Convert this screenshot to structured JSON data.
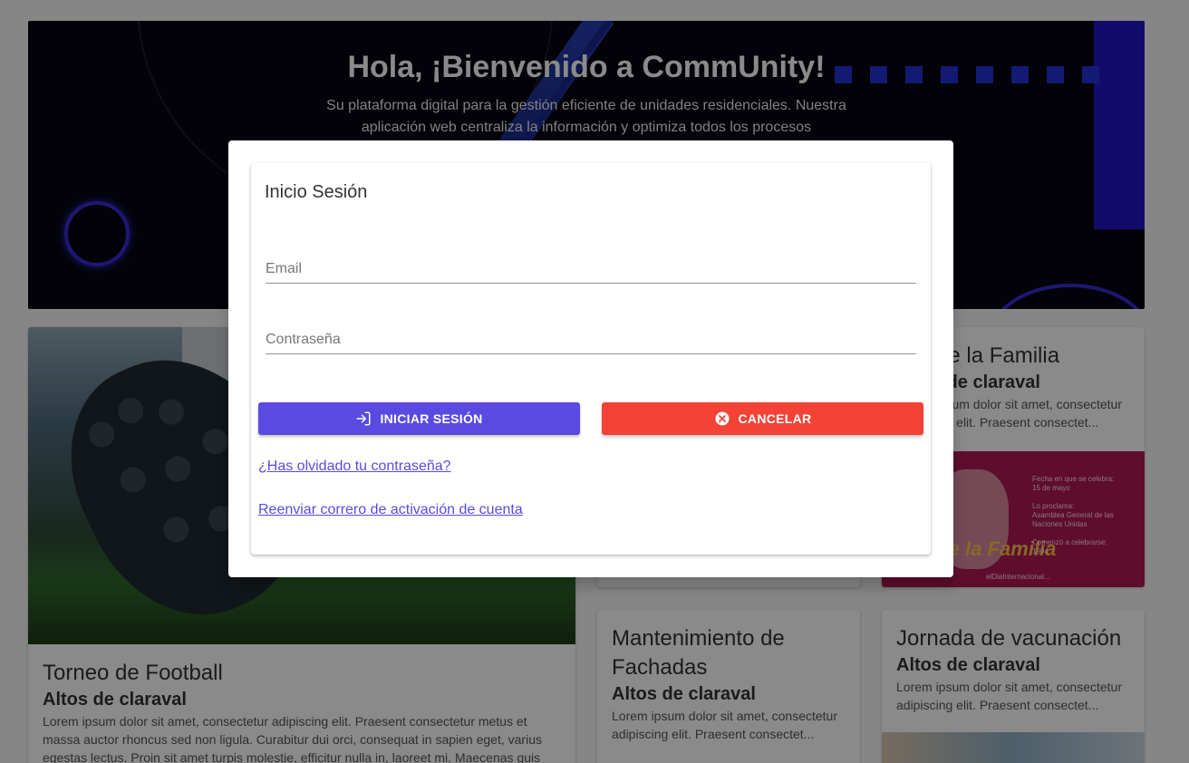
{
  "hero": {
    "title": "Hola, ¡Bienvenido a CommUnity!",
    "subtitle": "Su plataforma digital para la gestión eficiente de unidades residenciales. Nuestra aplicación web centraliza la información y optimiza todos los procesos"
  },
  "cards": {
    "football": {
      "title": "Torneo de Football",
      "subtitle": "Altos de claraval",
      "description": "Lorem ipsum dolor sit amet, consectetur adipiscing elit. Praesent consectetur metus et massa auctor rhoncus sed non ligula. Curabitur dui orci, consequat in sapien eget, varius egestas lectus. Proin sit amet turpis molestie, efficitur nulla in, laoreet mi. Maecenas quis"
    },
    "familia": {
      "title": "Día de la Familia",
      "subtitle": "Altos de claraval",
      "description": "Lorem ipsum dolor sit amet, consectetur adipiscing elit. Praesent consectet...",
      "image_heading": "Día de la Familia",
      "image_info_1_label": "Fecha en que se celebra:",
      "image_info_1_value": "15 de mayo",
      "image_info_2_label": "Lo proclama:",
      "image_info_2_value": "Asamblea General de las Naciones Unidas",
      "image_info_3_label": "Comenzó a celebrarse:",
      "image_info_3_value": "1994",
      "image_logo": "elDiaInternacional..."
    },
    "fachadas": {
      "title": "Mantenimiento de Fachadas",
      "subtitle": "Altos de claraval",
      "description": "Lorem ipsum dolor sit amet, consectetur adipiscing elit. Praesent consectet..."
    },
    "vacunacion": {
      "title": "Jornada de vacunación",
      "subtitle": "Altos de claraval",
      "description": "Lorem ipsum dolor sit amet, consectetur adipiscing elit. Praesent consectet..."
    }
  },
  "login": {
    "title": "Inicio Sesión",
    "email_placeholder": "Email",
    "email_value": "",
    "password_placeholder": "Contraseña",
    "password_value": "",
    "login_button": "INICIAR SESIÓN",
    "cancel_button": "CANCELAR",
    "forgot_link": "¿Has olvidado tu contraseña?",
    "resend_link": "Reenviar correro de activación de cuenta"
  },
  "colors": {
    "primary": "#5b4ae2",
    "danger": "#f44336",
    "hero_bg": "#05050f",
    "hero_accent": "#2416c8"
  },
  "icons": {
    "login": "login-icon",
    "cancel": "cancel-circle-icon"
  }
}
